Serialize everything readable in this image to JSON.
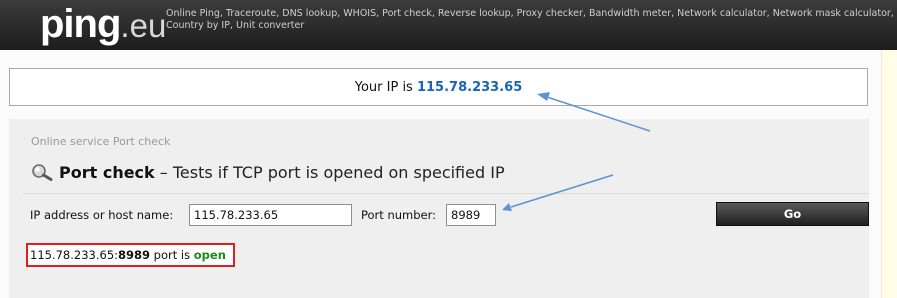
{
  "header": {
    "logo_main": "ping",
    "logo_tld": ".eu",
    "tagline": "Online Ping, Traceroute, DNS lookup, WHOIS, Port check, Reverse lookup, Proxy checker, Bandwidth meter, Network calculator, Network mask calculator, Country by IP, Unit converter"
  },
  "ip_banner": {
    "prefix": "Your IP is",
    "ip": "115.78.233.65"
  },
  "panel": {
    "breadcrumb": "Online service Port check",
    "title_bold": "Port check",
    "title_rest": " – Tests if TCP port is opened on specified IP",
    "icon": "magnifier-icon"
  },
  "form": {
    "host_label": "IP address or host name:",
    "host_value": "115.78.233.65",
    "port_label": "Port number:",
    "port_value": "8989",
    "go_label": "Go"
  },
  "result": {
    "host": "115.78.233.65:",
    "port": "8989",
    "middle": " port is ",
    "status": "open"
  },
  "colors": {
    "ip_link": "#1b63b5",
    "status_open": "#1c8b1c",
    "result_border": "#e02020",
    "annotation_arrow": "#5b93d3"
  }
}
